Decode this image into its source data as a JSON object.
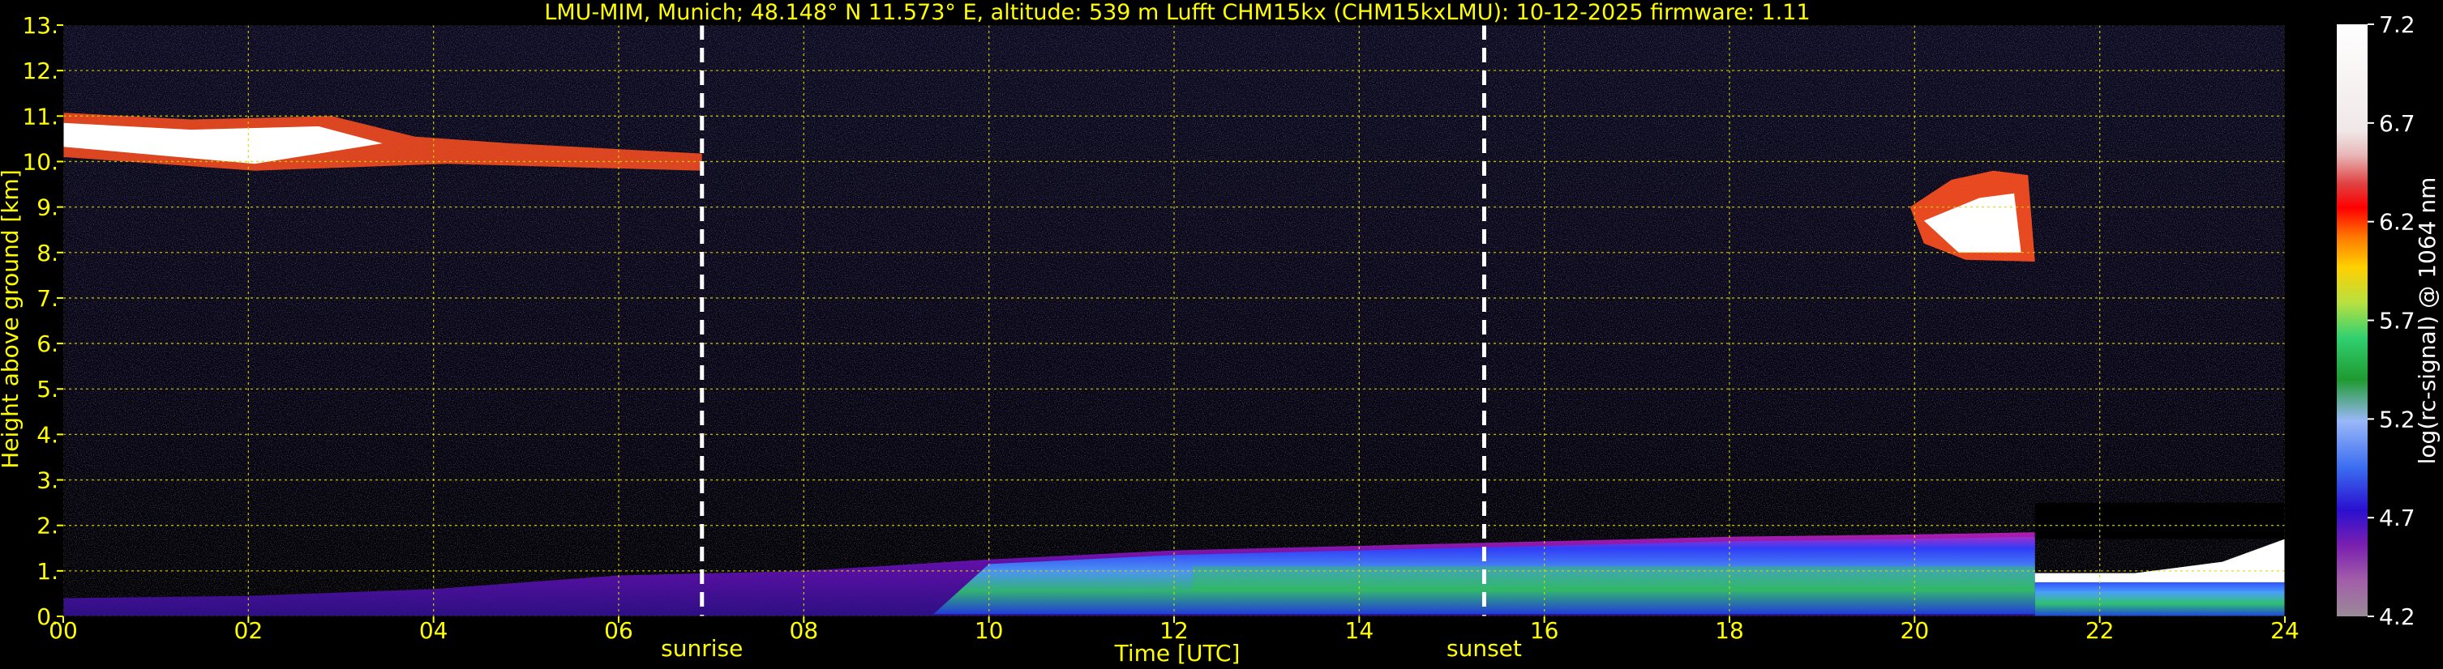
{
  "chart_data": {
    "type": "heatmap",
    "title": "LMU-MIM, Munich; 48.148° N 11.573° E, altitude: 539 m    Lufft CHM15kx (CHM15kxLMU): 10-12-2025    firmware: 1.11",
    "xlabel": "Time [UTC]",
    "ylabel": "Height above ground [km]",
    "xlim": [
      0,
      24
    ],
    "ylim": [
      0,
      13
    ],
    "x_ticks": [
      "00",
      "02",
      "04",
      "06",
      "08",
      "10",
      "12",
      "14",
      "16",
      "18",
      "20",
      "22",
      "24"
    ],
    "y_ticks": [
      "0.",
      "1.",
      "2.",
      "3.",
      "4.",
      "5.",
      "6.",
      "7.",
      "8.",
      "9.",
      "10.",
      "11.",
      "12.",
      "13."
    ],
    "grid": true,
    "events": [
      {
        "label": "sunrise",
        "time_h": 6.9
      },
      {
        "label": "sunset",
        "time_h": 15.35
      }
    ],
    "colorbar": {
      "label": "log(rc-signal) @ 1064 nm",
      "range": [
        4.2,
        7.2
      ],
      "ticks": [
        "7.2",
        "6.7",
        "6.2",
        "5.7",
        "5.2",
        "4.7",
        "4.2"
      ]
    },
    "features": [
      {
        "name": "cirrus",
        "t_start": 0,
        "t_end": 6.9,
        "h_bottom": 9.8,
        "h_top": 11.3
      },
      {
        "name": "cirrus",
        "t_start": 19.8,
        "t_end": 21.3,
        "h_bottom": 7.8,
        "h_top": 9.8
      },
      {
        "name": "boundary layer top",
        "times": [
          0,
          2,
          4,
          6,
          8,
          10,
          12,
          14,
          16,
          18,
          20,
          21.3
        ],
        "heights": [
          0.4,
          0.45,
          0.6,
          0.9,
          1.0,
          1.25,
          1.45,
          1.55,
          1.65,
          1.75,
          1.8,
          1.85
        ]
      },
      {
        "name": "low cloud",
        "t_start": 21.3,
        "t_end": 24,
        "h_bottom": 0.95,
        "h_top": 1.7
      }
    ]
  }
}
